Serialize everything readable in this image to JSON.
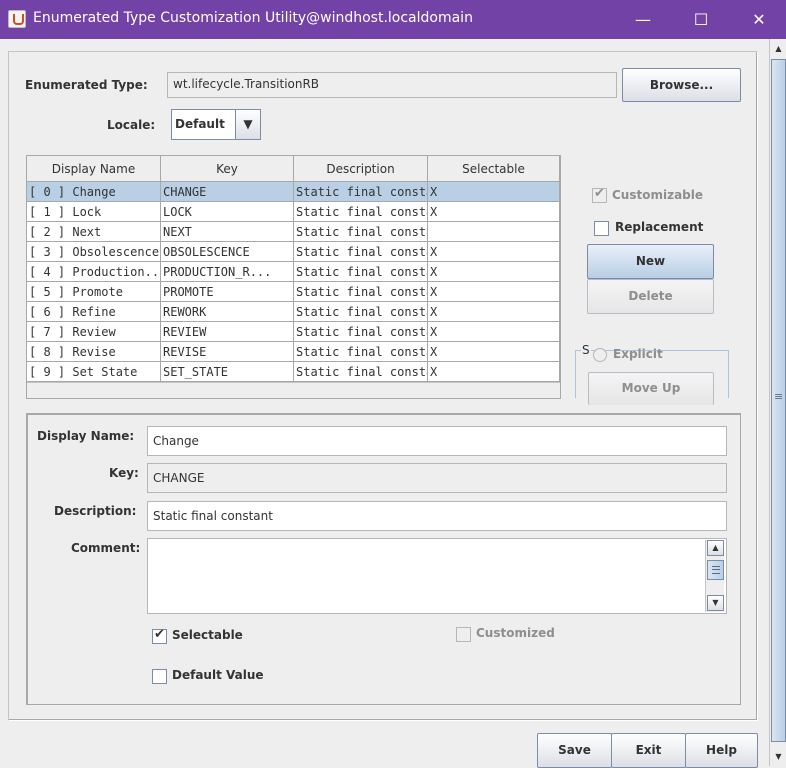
{
  "window": {
    "title": "Enumerated Type Customization Utility@windhost.localdomain",
    "minimize_glyph": "—",
    "maximize_glyph": "☐",
    "close_glyph": "✕",
    "icon": "java-cup-icon",
    "accent": "#7342a6"
  },
  "form": {
    "enum_type_label": "Enumerated Type:",
    "enum_type_value": "wt.lifecycle.TransitionRB",
    "browse_label": "Browse...",
    "locale_label": "Locale:",
    "locale_value": "Default",
    "locale_arrow": "▼"
  },
  "table": {
    "columns": [
      "Display Name",
      "Key",
      "Description",
      "Selectable"
    ],
    "rows": [
      {
        "display": "[ 0 ]  Change",
        "key": "CHANGE",
        "desc": "Static final constant",
        "sel": "X",
        "selected": true
      },
      {
        "display": "[ 1 ]  Lock",
        "key": "LOCK",
        "desc": "Static final constant.",
        "sel": "X"
      },
      {
        "display": "[ 2 ]  Next",
        "key": "NEXT",
        "desc": "Static final constant.",
        "sel": ""
      },
      {
        "display": "[ 3 ]  Obsolescence",
        "key": "OBSOLESCENCE",
        "desc": "Static final constant",
        "sel": "X"
      },
      {
        "display": "[ 4 ]  Production...",
        "key": "PRODUCTION_R...",
        "desc": "Static final constant",
        "sel": "X"
      },
      {
        "display": "[ 5 ]  Promote",
        "key": "PROMOTE",
        "desc": "Static final constant",
        "sel": "X"
      },
      {
        "display": "[ 6 ]  Refine",
        "key": "REWORK",
        "desc": "Static final constant.",
        "sel": "X"
      },
      {
        "display": "[ 7 ]  Review",
        "key": "REVIEW",
        "desc": "Static final constant",
        "sel": "X"
      },
      {
        "display": "[ 8 ]  Revise",
        "key": "REVISE",
        "desc": "Static final constant",
        "sel": "X"
      },
      {
        "display": "[ 9 ]  Set State",
        "key": "SET_STATE",
        "desc": "Static final constant",
        "sel": "X"
      }
    ]
  },
  "side": {
    "customizable_label": "Customizable",
    "replacement_label": "Replacement",
    "new_label": "New",
    "delete_label": "Delete",
    "group_letter": "S",
    "explicit_label": "Explicit",
    "move_up_label": "Move Up",
    "check_glyph": "✔"
  },
  "detail": {
    "display_name_label": "Display Name:",
    "display_name_value": "Change",
    "key_label": "Key:",
    "key_value": "CHANGE",
    "description_label": "Description:",
    "description_value": "Static final constant",
    "comment_label": "Comment:",
    "comment_value": "",
    "selectable_label": "Selectable",
    "customized_label": "Customized",
    "default_value_label": "Default Value",
    "up_arrow": "▲",
    "down_arrow": "▼"
  },
  "footer": {
    "save_label": "Save",
    "exit_label": "Exit",
    "help_label": "Help"
  }
}
